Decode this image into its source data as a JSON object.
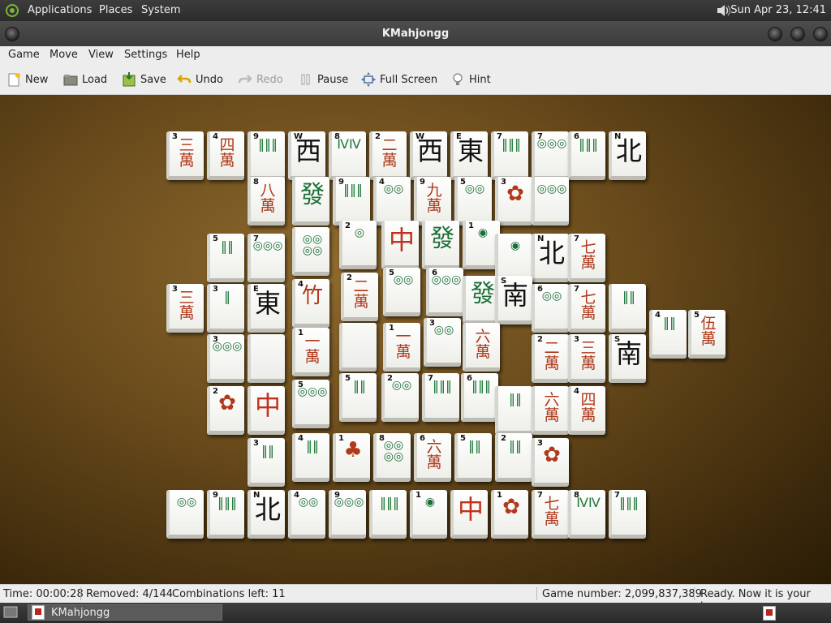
{
  "top_panel": {
    "menus": [
      "Applications",
      "Places",
      "System"
    ],
    "clock": "Sun Apr 23, 12:41"
  },
  "window": {
    "title": "KMahjongg"
  },
  "menubar": [
    "Game",
    "Move",
    "View",
    "Settings",
    "Help"
  ],
  "toolbar": {
    "new": "New",
    "load": "Load",
    "save": "Save",
    "undo": "Undo",
    "redo": "Redo",
    "pause": "Pause",
    "fullscreen": "Full Screen",
    "hint": "Hint"
  },
  "status": {
    "time": "Time: 00:00:28",
    "removed": "Removed: 4/144",
    "combinations": "Combinations left: 11",
    "game_number": "Game number: 2,099,837,389",
    "message": "Ready. Now it is your turn."
  },
  "taskbar": {
    "task_label": "KMahjongg"
  },
  "colors": {
    "bamboo": "#1f7a3a",
    "character": "#b0391c",
    "circle_green": "#1b6e37",
    "dragon_red": "#c0321b"
  },
  "tiles": [
    {
      "n": "3",
      "s": "三\n萬"
    },
    {
      "n": "4",
      "s": "四\n萬"
    },
    {
      "n": "9",
      "s": "‖‖‖"
    },
    {
      "n": "W",
      "s": "西"
    },
    {
      "n": "8",
      "s": "ⅣⅣ"
    },
    {
      "n": "2",
      "s": "二\n萬"
    },
    {
      "n": "W",
      "s": "西"
    },
    {
      "n": "E",
      "s": "東"
    },
    {
      "n": "7",
      "s": "‖‖‖"
    },
    {
      "n": "7",
      "s": "◎◎◎"
    },
    {
      "n": "6",
      "s": "‖‖‖"
    },
    {
      "n": "N",
      "s": "北"
    },
    {
      "n": "8",
      "s": "八\n萬"
    },
    {
      "n": "",
      "s": "發"
    },
    {
      "n": "9",
      "s": "‖‖‖"
    },
    {
      "n": "4",
      "s": "◎◎"
    },
    {
      "n": "9",
      "s": "九\n萬"
    },
    {
      "n": "5",
      "s": "◎◎"
    },
    {
      "n": "3",
      "s": "✿"
    },
    {
      "n": "",
      "s": "◎◎◎"
    },
    {
      "n": "5",
      "s": "‖‖"
    },
    {
      "n": "7",
      "s": "◎◎◎"
    },
    {
      "n": "",
      "s": "◎◎\n◎◎"
    },
    {
      "n": "2",
      "s": "◎"
    },
    {
      "n": "",
      "s": "中"
    },
    {
      "n": "",
      "s": "發"
    },
    {
      "n": "1",
      "s": "◉"
    },
    {
      "n": "",
      "s": "◉"
    },
    {
      "n": "N",
      "s": "北"
    },
    {
      "n": "7",
      "s": "七\n萬"
    },
    {
      "n": "3",
      "s": "三\n萬"
    },
    {
      "n": "3",
      "s": "‖"
    },
    {
      "n": "E",
      "s": "東"
    },
    {
      "n": "4",
      "s": "竹"
    },
    {
      "n": "2",
      "s": "二\n萬"
    },
    {
      "n": "5",
      "s": "◎◎"
    },
    {
      "n": "6",
      "s": "◎◎◎"
    },
    {
      "n": "",
      "s": "發"
    },
    {
      "n": "S",
      "s": "南"
    },
    {
      "n": "6",
      "s": "◎◎"
    },
    {
      "n": "7",
      "s": "七\n萬"
    },
    {
      "n": "",
      "s": "‖‖"
    },
    {
      "n": "4",
      "s": "‖‖"
    },
    {
      "n": "5",
      "s": "伍\n萬"
    },
    {
      "n": "3",
      "s": "◎◎◎"
    },
    {
      "n": "",
      "s": ""
    },
    {
      "n": "1",
      "s": "一\n萬"
    },
    {
      "n": "",
      "s": ""
    },
    {
      "n": "1",
      "s": "一\n萬"
    },
    {
      "n": "3",
      "s": "◎◎"
    },
    {
      "n": "",
      "s": "六\n萬"
    },
    {
      "n": "2",
      "s": "二\n萬"
    },
    {
      "n": "3",
      "s": "三\n萬"
    },
    {
      "n": "S",
      "s": "南"
    },
    {
      "n": "2",
      "s": "✿"
    },
    {
      "n": "",
      "s": "中"
    },
    {
      "n": "5",
      "s": "◎◎◎"
    },
    {
      "n": "5",
      "s": "‖‖"
    },
    {
      "n": "2",
      "s": "◎◎"
    },
    {
      "n": "7",
      "s": "‖‖‖"
    },
    {
      "n": "6",
      "s": "‖‖‖"
    },
    {
      "n": "",
      "s": "‖‖"
    },
    {
      "n": "",
      "s": "六\n萬"
    },
    {
      "n": "4",
      "s": "四\n萬"
    },
    {
      "n": "3",
      "s": "‖‖"
    },
    {
      "n": "4",
      "s": "‖‖"
    },
    {
      "n": "1",
      "s": "♣"
    },
    {
      "n": "8",
      "s": "◎◎\n◎◎"
    },
    {
      "n": "6",
      "s": "六\n萬"
    },
    {
      "n": "5",
      "s": "‖‖"
    },
    {
      "n": "2",
      "s": "‖‖"
    },
    {
      "n": "3",
      "s": "✿"
    },
    {
      "n": "",
      "s": "◎◎"
    },
    {
      "n": "9",
      "s": "‖‖‖"
    },
    {
      "n": "N",
      "s": "北"
    },
    {
      "n": "4",
      "s": "◎◎"
    },
    {
      "n": "9",
      "s": "◎◎◎"
    },
    {
      "n": "",
      "s": "‖‖‖"
    },
    {
      "n": "1",
      "s": "◉"
    },
    {
      "n": "",
      "s": "中"
    },
    {
      "n": "1",
      "s": "✿"
    },
    {
      "n": "7",
      "s": "七\n萬"
    },
    {
      "n": "8",
      "s": "ⅣⅣ"
    },
    {
      "n": "7",
      "s": "‖‖‖"
    }
  ]
}
